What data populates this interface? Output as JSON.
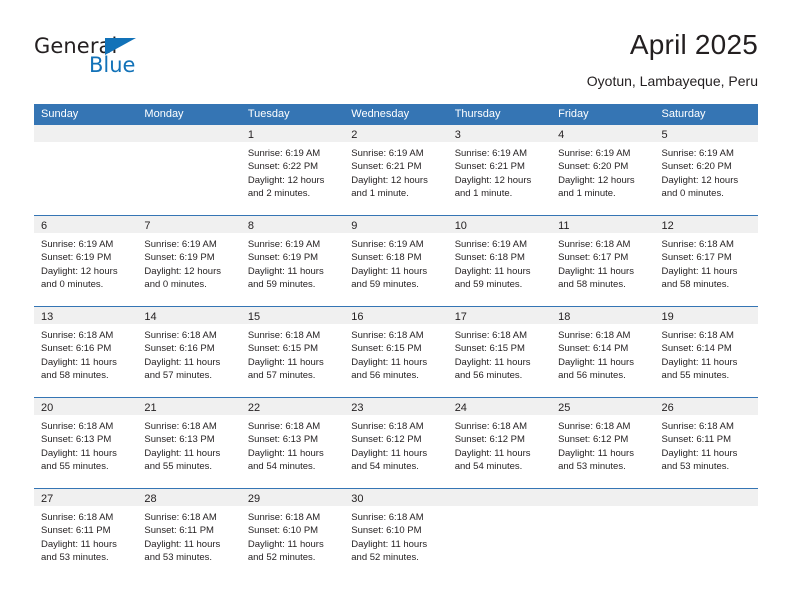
{
  "brand": {
    "name_part1": "General",
    "name_part2": "Blue",
    "triangle_icon": "triangle-icon",
    "accent_color": "#1272b8"
  },
  "header": {
    "title": "April 2025",
    "subtitle": "Oyotun, Lambayeque, Peru"
  },
  "calendar": {
    "header_bg": "#3575b4",
    "day_band_bg": "#f0f0f0",
    "weekday_headers": [
      "Sunday",
      "Monday",
      "Tuesday",
      "Wednesday",
      "Thursday",
      "Friday",
      "Saturday"
    ],
    "weeks": [
      [
        {
          "day": "",
          "sunrise": "",
          "sunset": "",
          "daylight_line1": "",
          "daylight_line2": ""
        },
        {
          "day": "",
          "sunrise": "",
          "sunset": "",
          "daylight_line1": "",
          "daylight_line2": ""
        },
        {
          "day": "1",
          "sunrise": "Sunrise: 6:19 AM",
          "sunset": "Sunset: 6:22 PM",
          "daylight_line1": "Daylight: 12 hours",
          "daylight_line2": "and 2 minutes."
        },
        {
          "day": "2",
          "sunrise": "Sunrise: 6:19 AM",
          "sunset": "Sunset: 6:21 PM",
          "daylight_line1": "Daylight: 12 hours",
          "daylight_line2": "and 1 minute."
        },
        {
          "day": "3",
          "sunrise": "Sunrise: 6:19 AM",
          "sunset": "Sunset: 6:21 PM",
          "daylight_line1": "Daylight: 12 hours",
          "daylight_line2": "and 1 minute."
        },
        {
          "day": "4",
          "sunrise": "Sunrise: 6:19 AM",
          "sunset": "Sunset: 6:20 PM",
          "daylight_line1": "Daylight: 12 hours",
          "daylight_line2": "and 1 minute."
        },
        {
          "day": "5",
          "sunrise": "Sunrise: 6:19 AM",
          "sunset": "Sunset: 6:20 PM",
          "daylight_line1": "Daylight: 12 hours",
          "daylight_line2": "and 0 minutes."
        }
      ],
      [
        {
          "day": "6",
          "sunrise": "Sunrise: 6:19 AM",
          "sunset": "Sunset: 6:19 PM",
          "daylight_line1": "Daylight: 12 hours",
          "daylight_line2": "and 0 minutes."
        },
        {
          "day": "7",
          "sunrise": "Sunrise: 6:19 AM",
          "sunset": "Sunset: 6:19 PM",
          "daylight_line1": "Daylight: 12 hours",
          "daylight_line2": "and 0 minutes."
        },
        {
          "day": "8",
          "sunrise": "Sunrise: 6:19 AM",
          "sunset": "Sunset: 6:19 PM",
          "daylight_line1": "Daylight: 11 hours",
          "daylight_line2": "and 59 minutes."
        },
        {
          "day": "9",
          "sunrise": "Sunrise: 6:19 AM",
          "sunset": "Sunset: 6:18 PM",
          "daylight_line1": "Daylight: 11 hours",
          "daylight_line2": "and 59 minutes."
        },
        {
          "day": "10",
          "sunrise": "Sunrise: 6:19 AM",
          "sunset": "Sunset: 6:18 PM",
          "daylight_line1": "Daylight: 11 hours",
          "daylight_line2": "and 59 minutes."
        },
        {
          "day": "11",
          "sunrise": "Sunrise: 6:18 AM",
          "sunset": "Sunset: 6:17 PM",
          "daylight_line1": "Daylight: 11 hours",
          "daylight_line2": "and 58 minutes."
        },
        {
          "day": "12",
          "sunrise": "Sunrise: 6:18 AM",
          "sunset": "Sunset: 6:17 PM",
          "daylight_line1": "Daylight: 11 hours",
          "daylight_line2": "and 58 minutes."
        }
      ],
      [
        {
          "day": "13",
          "sunrise": "Sunrise: 6:18 AM",
          "sunset": "Sunset: 6:16 PM",
          "daylight_line1": "Daylight: 11 hours",
          "daylight_line2": "and 58 minutes."
        },
        {
          "day": "14",
          "sunrise": "Sunrise: 6:18 AM",
          "sunset": "Sunset: 6:16 PM",
          "daylight_line1": "Daylight: 11 hours",
          "daylight_line2": "and 57 minutes."
        },
        {
          "day": "15",
          "sunrise": "Sunrise: 6:18 AM",
          "sunset": "Sunset: 6:15 PM",
          "daylight_line1": "Daylight: 11 hours",
          "daylight_line2": "and 57 minutes."
        },
        {
          "day": "16",
          "sunrise": "Sunrise: 6:18 AM",
          "sunset": "Sunset: 6:15 PM",
          "daylight_line1": "Daylight: 11 hours",
          "daylight_line2": "and 56 minutes."
        },
        {
          "day": "17",
          "sunrise": "Sunrise: 6:18 AM",
          "sunset": "Sunset: 6:15 PM",
          "daylight_line1": "Daylight: 11 hours",
          "daylight_line2": "and 56 minutes."
        },
        {
          "day": "18",
          "sunrise": "Sunrise: 6:18 AM",
          "sunset": "Sunset: 6:14 PM",
          "daylight_line1": "Daylight: 11 hours",
          "daylight_line2": "and 56 minutes."
        },
        {
          "day": "19",
          "sunrise": "Sunrise: 6:18 AM",
          "sunset": "Sunset: 6:14 PM",
          "daylight_line1": "Daylight: 11 hours",
          "daylight_line2": "and 55 minutes."
        }
      ],
      [
        {
          "day": "20",
          "sunrise": "Sunrise: 6:18 AM",
          "sunset": "Sunset: 6:13 PM",
          "daylight_line1": "Daylight: 11 hours",
          "daylight_line2": "and 55 minutes."
        },
        {
          "day": "21",
          "sunrise": "Sunrise: 6:18 AM",
          "sunset": "Sunset: 6:13 PM",
          "daylight_line1": "Daylight: 11 hours",
          "daylight_line2": "and 55 minutes."
        },
        {
          "day": "22",
          "sunrise": "Sunrise: 6:18 AM",
          "sunset": "Sunset: 6:13 PM",
          "daylight_line1": "Daylight: 11 hours",
          "daylight_line2": "and 54 minutes."
        },
        {
          "day": "23",
          "sunrise": "Sunrise: 6:18 AM",
          "sunset": "Sunset: 6:12 PM",
          "daylight_line1": "Daylight: 11 hours",
          "daylight_line2": "and 54 minutes."
        },
        {
          "day": "24",
          "sunrise": "Sunrise: 6:18 AM",
          "sunset": "Sunset: 6:12 PM",
          "daylight_line1": "Daylight: 11 hours",
          "daylight_line2": "and 54 minutes."
        },
        {
          "day": "25",
          "sunrise": "Sunrise: 6:18 AM",
          "sunset": "Sunset: 6:12 PM",
          "daylight_line1": "Daylight: 11 hours",
          "daylight_line2": "and 53 minutes."
        },
        {
          "day": "26",
          "sunrise": "Sunrise: 6:18 AM",
          "sunset": "Sunset: 6:11 PM",
          "daylight_line1": "Daylight: 11 hours",
          "daylight_line2": "and 53 minutes."
        }
      ],
      [
        {
          "day": "27",
          "sunrise": "Sunrise: 6:18 AM",
          "sunset": "Sunset: 6:11 PM",
          "daylight_line1": "Daylight: 11 hours",
          "daylight_line2": "and 53 minutes."
        },
        {
          "day": "28",
          "sunrise": "Sunrise: 6:18 AM",
          "sunset": "Sunset: 6:11 PM",
          "daylight_line1": "Daylight: 11 hours",
          "daylight_line2": "and 53 minutes."
        },
        {
          "day": "29",
          "sunrise": "Sunrise: 6:18 AM",
          "sunset": "Sunset: 6:10 PM",
          "daylight_line1": "Daylight: 11 hours",
          "daylight_line2": "and 52 minutes."
        },
        {
          "day": "30",
          "sunrise": "Sunrise: 6:18 AM",
          "sunset": "Sunset: 6:10 PM",
          "daylight_line1": "Daylight: 11 hours",
          "daylight_line2": "and 52 minutes."
        },
        {
          "day": "",
          "sunrise": "",
          "sunset": "",
          "daylight_line1": "",
          "daylight_line2": ""
        },
        {
          "day": "",
          "sunrise": "",
          "sunset": "",
          "daylight_line1": "",
          "daylight_line2": ""
        },
        {
          "day": "",
          "sunrise": "",
          "sunset": "",
          "daylight_line1": "",
          "daylight_line2": ""
        }
      ]
    ]
  }
}
